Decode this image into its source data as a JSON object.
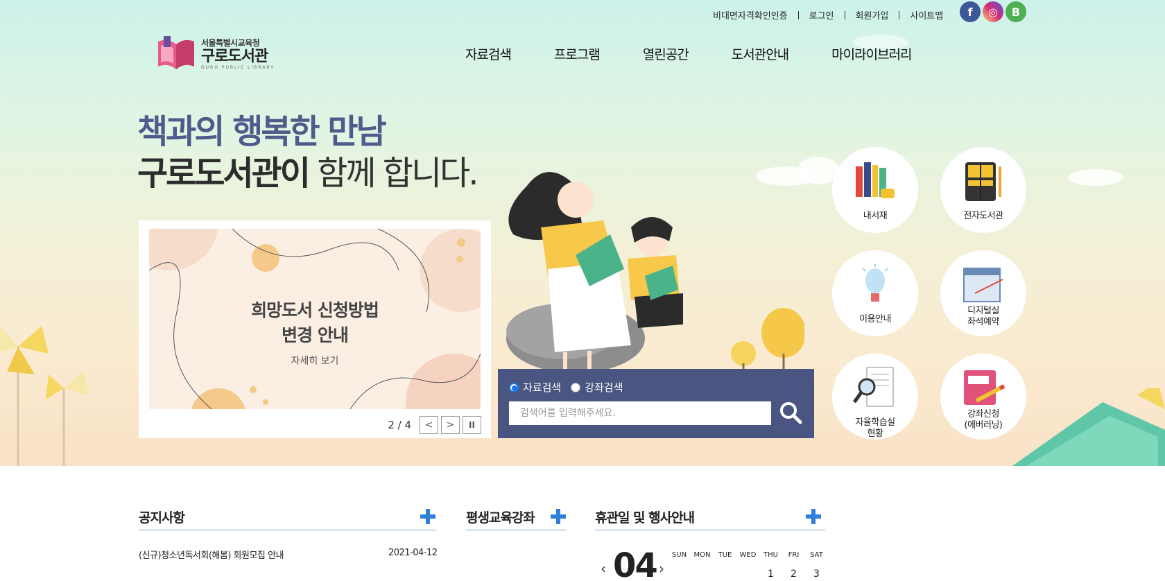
{
  "utility": {
    "links": [
      "비대면자격확인인증",
      "로그인",
      "회원가입",
      "사이트맵"
    ],
    "sns": [
      {
        "name": "facebook",
        "glyph": "f",
        "color": "#3b5998"
      },
      {
        "name": "instagram",
        "glyph": "◎",
        "color": "#d62976"
      },
      {
        "name": "blog",
        "glyph": "B",
        "color": "#4caf50"
      }
    ]
  },
  "logo": {
    "org": "서울특별시교육청",
    "name": "구로도서관",
    "eng": "GURO PUBLIC LIBRARY"
  },
  "gnb": [
    "자료검색",
    "프로그램",
    "열린공간",
    "도서관안내",
    "마이라이브러리"
  ],
  "headline": {
    "line1": "책과의 행복한 만남",
    "line2_bold": "구로도서관이",
    "line2_rest": " 함께 합니다."
  },
  "banner": {
    "title_line1": "희망도서 신청방법",
    "title_line2": "변경 안내",
    "more": "자세히 보기",
    "page": "2 / 4",
    "prev": "<",
    "next": ">",
    "pause": "II"
  },
  "search": {
    "options": [
      "자료검색",
      "강좌검색"
    ],
    "selected": "자료검색",
    "placeholder": "검색어를 입력해주세요."
  },
  "quick_menu": [
    {
      "label": "내서재",
      "icon": "books-icon"
    },
    {
      "label": "전자도서관",
      "icon": "ebook-icon"
    },
    {
      "label": "이용안내",
      "icon": "lightbulb-icon"
    },
    {
      "label": "디지털실 좌석예약",
      "line1": "디지털실",
      "line2": "좌석예약",
      "icon": "calendar-icon"
    },
    {
      "label": "자율학습실 현황",
      "line1": "자율학습실",
      "line2": "현황",
      "icon": "magnifier-icon"
    },
    {
      "label": "강좌신청 (에버러닝)",
      "line1": "강좌신청",
      "line2": "(에버러닝)",
      "icon": "book-pencil-icon"
    }
  ],
  "sections": {
    "notice": {
      "title": "공지사항",
      "items": [
        {
          "title": "(신규)청소년독서회(해봄) 회원모집 안내",
          "date": "2021-04-12"
        }
      ]
    },
    "lifelong": {
      "title": "평생교육강좌"
    },
    "calendar": {
      "title": "휴관일 및 행사안내",
      "month": "04",
      "prev": "‹",
      "next": "›",
      "days": [
        "SUN",
        "MON",
        "TUE",
        "WED",
        "THU",
        "FRI",
        "SAT"
      ],
      "first_week": [
        "",
        "",
        "",
        "",
        "1",
        "2",
        "3"
      ]
    }
  },
  "colors": {
    "accent_navy": "#4b5582",
    "headline_blue": "#4e5b8b",
    "plus_blue": "#2f7fd9"
  }
}
